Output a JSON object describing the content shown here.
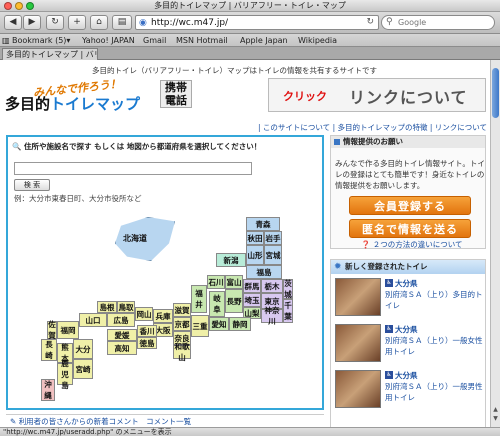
{
  "window": {
    "title": "多目的トイレマップ | バリアフリー・トイレ・マップ"
  },
  "toolbar": {
    "url": "http://wc.m47.jp/",
    "search_placeholder": "Google"
  },
  "bookmarks": [
    "Bookmark (5)▾",
    "Yahoo! JAPAN",
    "Gmail",
    "MSN Hotmail",
    "Apple Japan",
    "Wikipedia"
  ],
  "tab": {
    "label": "多目的トイレマップ | バリア..."
  },
  "header": {
    "description": "多目的トイレ（バリアフリー・トイレ）マップはトイレの情報を共有するサイトです",
    "logo_sub": "みんなで作ろう！",
    "logo_main_a": "多目的",
    "logo_main_b": "トイレマップ",
    "mobile_line1": "携帯",
    "mobile_line2": "電話",
    "banner_click": "クリック",
    "banner_text": "リンクについて"
  },
  "nav": {
    "text": "| このサイトについて | 多目的トイレマップの特徴 | リンクについて |"
  },
  "search": {
    "title": "住所や施設名で探す もしくは 地図から都道府県を選択してください！",
    "button": "検 索",
    "example": "例：大分市東春日町、大分市役所など"
  },
  "map": {
    "hokkaido": "北海道",
    "prefectures": [
      {
        "name": "青森",
        "color": "#b8d6f0"
      },
      {
        "name": "秋田",
        "color": "#b8d6f0"
      },
      {
        "name": "岩手",
        "color": "#b8d6f0"
      },
      {
        "name": "山形",
        "color": "#b8d6f0"
      },
      {
        "name": "宮城",
        "color": "#b8d6f0"
      },
      {
        "name": "新潟",
        "color": "#b8ecd8"
      },
      {
        "name": "福島",
        "color": "#b8d6f0"
      },
      {
        "name": "石川",
        "color": "#c8e8b0"
      },
      {
        "name": "富山",
        "color": "#c8e8b0"
      },
      {
        "name": "群馬",
        "color": "#d8c8f0"
      },
      {
        "name": "栃木",
        "color": "#d8c8f0"
      },
      {
        "name": "茨城",
        "color": "#d8c8f0"
      },
      {
        "name": "福井",
        "color": "#c8e8b0"
      },
      {
        "name": "長野",
        "color": "#c8e8b0"
      },
      {
        "name": "埼玉",
        "color": "#d8c8f0"
      },
      {
        "name": "岐阜",
        "color": "#c8e8b0"
      },
      {
        "name": "山梨",
        "color": "#c8e8b0"
      },
      {
        "name": "東京",
        "color": "#d8c8f0"
      },
      {
        "name": "千葉",
        "color": "#d8c8f0"
      },
      {
        "name": "滋賀",
        "color": "#f0f0a8"
      },
      {
        "name": "愛知",
        "color": "#c8e8b0"
      },
      {
        "name": "静岡",
        "color": "#c8e8b0"
      },
      {
        "name": "神奈川",
        "color": "#d8c8f0"
      },
      {
        "name": "京都",
        "color": "#f0f0a8"
      },
      {
        "name": "三重",
        "color": "#f0f0a8"
      },
      {
        "name": "兵庫",
        "color": "#f0f0a8"
      },
      {
        "name": "大阪",
        "color": "#f0f0a8"
      },
      {
        "name": "奈良",
        "color": "#f0f0a8"
      },
      {
        "name": "和歌山",
        "color": "#f0f0a8"
      },
      {
        "name": "鳥取",
        "color": "#f0f0a8"
      },
      {
        "name": "島根",
        "color": "#f0f0a8"
      },
      {
        "name": "岡山",
        "color": "#f0f0a8"
      },
      {
        "name": "広島",
        "color": "#f0f0a8"
      },
      {
        "name": "山口",
        "color": "#f0f0a8"
      },
      {
        "name": "香川",
        "color": "#f0f0a8"
      },
      {
        "name": "徳島",
        "color": "#f0f0a8"
      },
      {
        "name": "愛媛",
        "color": "#f0f0a8"
      },
      {
        "name": "高知",
        "color": "#f0f0a8"
      },
      {
        "name": "福岡",
        "color": "#f0f0a8"
      },
      {
        "name": "佐賀",
        "color": "#f0f0a8"
      },
      {
        "name": "長崎",
        "color": "#f0f0a8"
      },
      {
        "name": "大分",
        "color": "#f0f0a8"
      },
      {
        "name": "熊本",
        "color": "#f0f0a8"
      },
      {
        "name": "宮崎",
        "color": "#f0f0a8"
      },
      {
        "name": "鹿児島",
        "color": "#f0f0a8"
      },
      {
        "name": "沖縄",
        "color": "#f0c0c0"
      }
    ]
  },
  "comment": {
    "text": "利用者の皆さんからの新着コメント　コメント一覧"
  },
  "info": {
    "title": "情報提供のお願い",
    "body": "みんなで作る多目的トイレ情報サイト。トイレの登録はとても簡単です！身近なトイレの情報提供をお願いします。",
    "register_button": "会員登録する",
    "anonymous_button": "匿名で情報を送る",
    "diff_link": "２つの方法の違いについて"
  },
  "new_toilets": {
    "title": "新しく登録されたトイレ",
    "items": [
      {
        "pref": "大分県",
        "name": "別府湾ＳＡ（上り）多目的トイレ"
      },
      {
        "pref": "大分県",
        "name": "別府湾ＳＡ（上り）一般女性用トイレ"
      },
      {
        "pref": "大分県",
        "name": "別府湾ＳＡ（上り）一般男性用トイレ"
      }
    ]
  },
  "status": {
    "text": "\"http://wc.m47.jp/useradd.php\" のメニューを表示"
  }
}
